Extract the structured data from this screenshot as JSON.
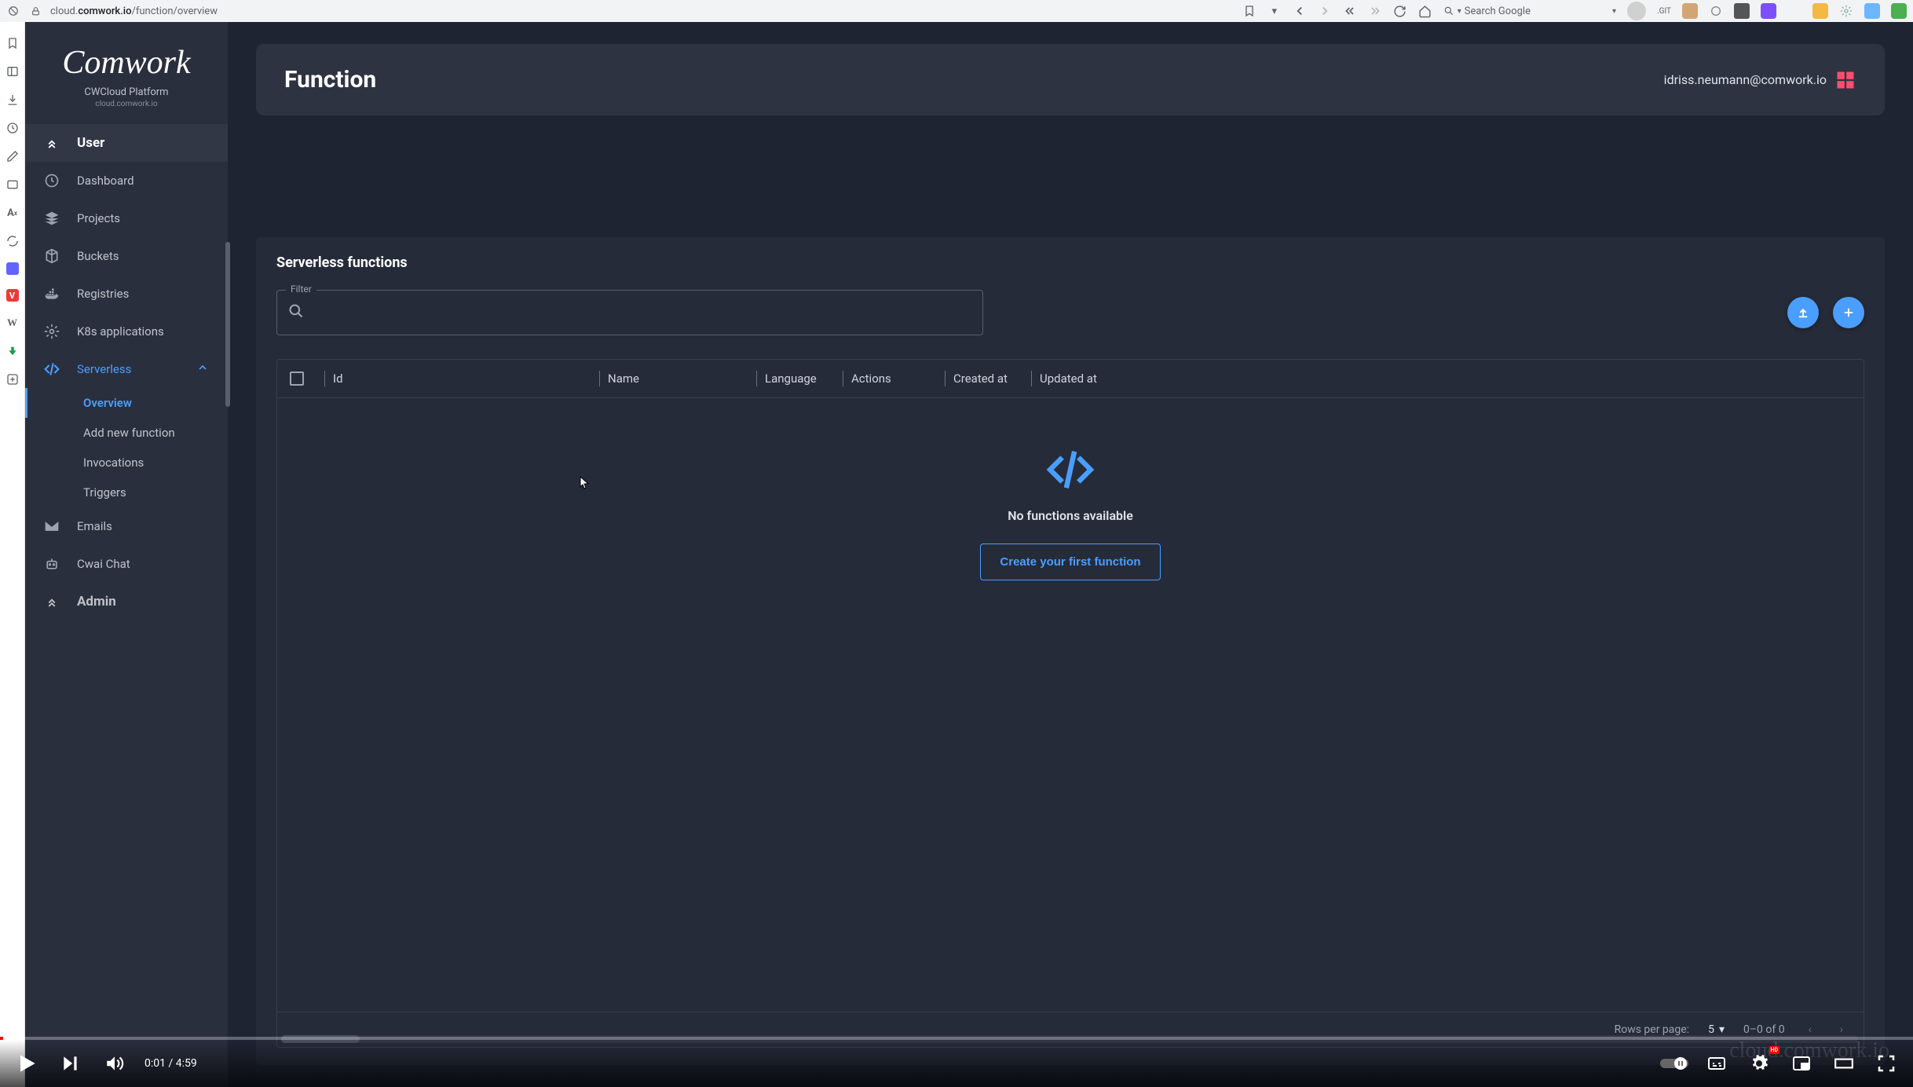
{
  "browser": {
    "url_prefix": "cloud.",
    "url_domain": "comwork.io",
    "url_path": "/function/overview",
    "search_placeholder": "Search Google",
    "git_label": ".GIT"
  },
  "sidebar": {
    "logo_text": "Comwork",
    "platform_name": "CWCloud Platform",
    "platform_url": "cloud.comwork.io",
    "group_user": "User",
    "items": {
      "dashboard": "Dashboard",
      "projects": "Projects",
      "buckets": "Buckets",
      "registries": "Registries",
      "k8s": "K8s applications",
      "serverless": "Serverless",
      "emails": "Emails",
      "cwai": "Cwai Chat"
    },
    "sub": {
      "overview": "Overview",
      "add": "Add new function",
      "invocations": "Invocations",
      "triggers": "Triggers"
    },
    "group_admin": "Admin"
  },
  "header": {
    "title": "Function",
    "user_email": "idriss.neumann@comwork.io"
  },
  "section": {
    "title": "Serverless functions",
    "filter_label": "Filter"
  },
  "table": {
    "cols": {
      "id": "Id",
      "name": "Name",
      "language": "Language",
      "actions": "Actions",
      "created": "Created at",
      "updated": "Updated at"
    },
    "empty_text": "No functions available",
    "empty_button": "Create your first function"
  },
  "pagination": {
    "rows_label": "Rows per page:",
    "rows_value": "5",
    "range": "0–0 of 0"
  },
  "video": {
    "time_current": "0:01",
    "time_sep": " / ",
    "time_total": "4:59",
    "hd": "HD"
  },
  "watermark": "cloud.comwork.io"
}
